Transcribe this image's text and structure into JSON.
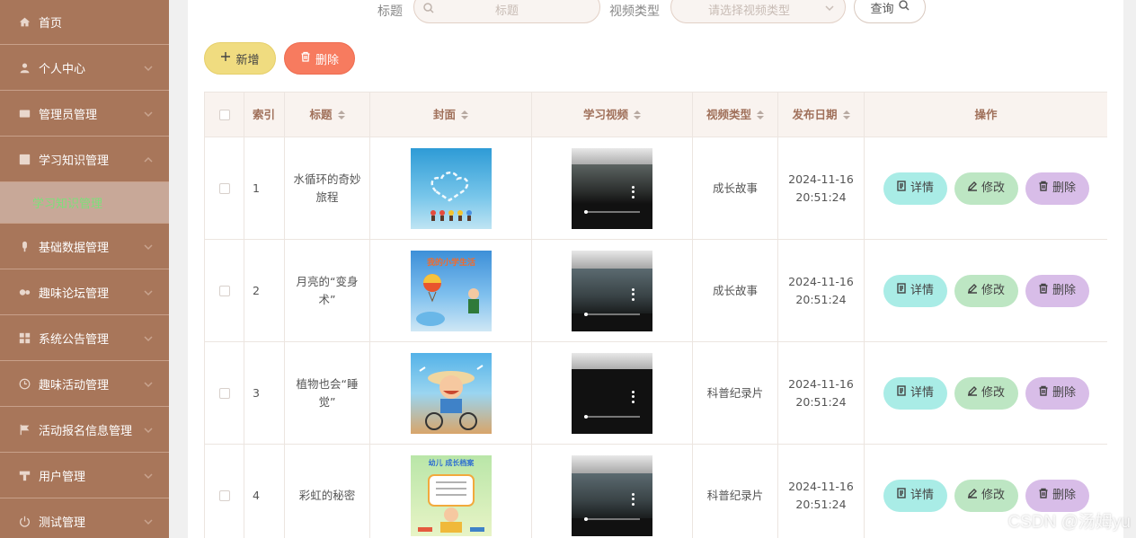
{
  "sidebar": {
    "items": [
      {
        "label": "首页",
        "icon": "home-icon",
        "chevron": false
      },
      {
        "label": "个人中心",
        "icon": "user-icon",
        "chevron": true
      },
      {
        "label": "管理员管理",
        "icon": "admin-icon",
        "chevron": true
      },
      {
        "label": "学习知识管理",
        "icon": "chart-icon",
        "chevron": true,
        "expanded": true
      },
      {
        "label": "基础数据管理",
        "icon": "mic-icon",
        "chevron": true
      },
      {
        "label": "趣味论坛管理",
        "icon": "gears-icon",
        "chevron": true
      },
      {
        "label": "系统公告管理",
        "icon": "grid-icon",
        "chevron": true
      },
      {
        "label": "趣味活动管理",
        "icon": "clock-icon",
        "chevron": true
      },
      {
        "label": "活动报名信息管理",
        "icon": "flag-icon",
        "chevron": true
      },
      {
        "label": "用户管理",
        "icon": "podium-icon",
        "chevron": true
      },
      {
        "label": "测试管理",
        "icon": "power-icon",
        "chevron": true
      }
    ],
    "submenu": {
      "label": "学习知识管理"
    }
  },
  "search": {
    "title_label": "标题",
    "title_placeholder": "标题",
    "type_label": "视频类型",
    "type_placeholder": "请选择视频类型",
    "query_label": "查询"
  },
  "toolbar": {
    "add_label": "新增",
    "delete_label": "删除"
  },
  "table": {
    "headers": {
      "index": "索引",
      "title": "标题",
      "cover": "封面",
      "video": "学习视频",
      "type": "视频类型",
      "date": "发布日期",
      "ops": "操作"
    },
    "rows": [
      {
        "index": "1",
        "title": "水循环的奇妙旅程",
        "type": "成长故事",
        "date": "2024-11-16 20:51:24"
      },
      {
        "index": "2",
        "title": "月亮的“变身术”",
        "type": "成长故事",
        "date": "2024-11-16 20:51:24"
      },
      {
        "index": "3",
        "title": "植物也会“睡觉”",
        "type": "科普纪录片",
        "date": "2024-11-16 20:51:24"
      },
      {
        "index": "4",
        "title": "彩虹的秘密",
        "type": "科普纪录片",
        "date": "2024-11-16 20:51:24"
      }
    ],
    "op_labels": {
      "detail": "详情",
      "edit": "修改",
      "delete": "删除"
    }
  },
  "covers": [
    {
      "text": ""
    },
    {
      "text": "我的小学生活"
    },
    {
      "text": ""
    },
    {
      "text": "幼儿 成长档案"
    }
  ],
  "watermark": "CSDN @汤姆yu",
  "colors": {
    "sidebar": "#a8765a",
    "submenu_text": "#7ce07a",
    "add": "#f0dc80",
    "delete": "#f77b5f",
    "detail": "#a9ece6",
    "edit": "#bde6c3",
    "op_delete": "#d8bde8"
  }
}
